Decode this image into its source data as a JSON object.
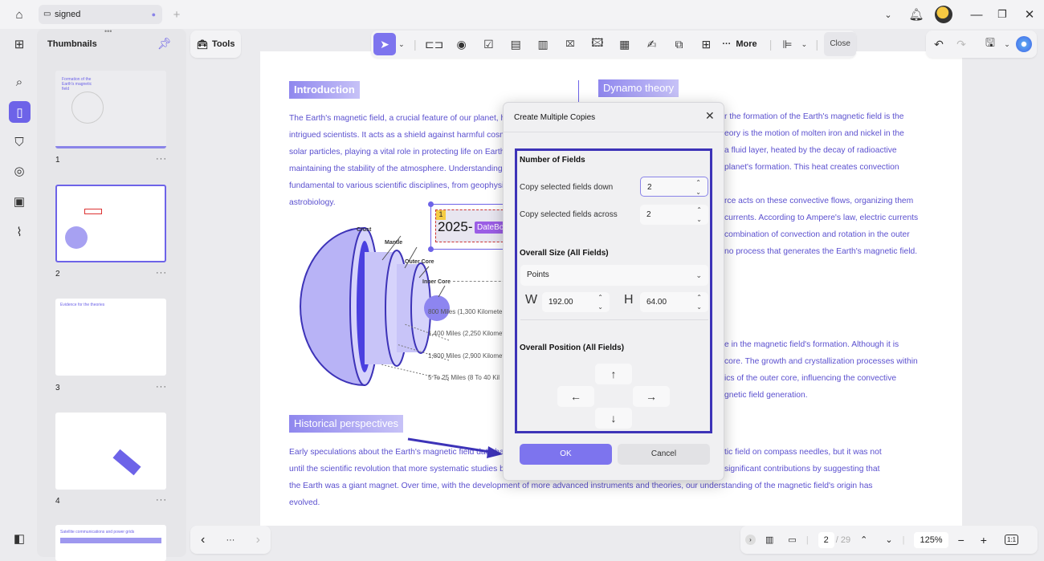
{
  "titlebar": {
    "tab_title": "signed",
    "icons": [
      "home-icon",
      "comment-icon",
      "plus-icon",
      "chevron-down-icon",
      "bell-icon",
      "avatar",
      "minimize-icon",
      "maximize-icon",
      "close-icon"
    ]
  },
  "rail": {
    "icons": [
      "grid-icon",
      "search-icon",
      "pages-icon",
      "bookmark-icon",
      "comment-search-icon",
      "stamp-icon",
      "attachment-icon",
      "layers-icon"
    ]
  },
  "thumbnails": {
    "title": "Thumbnails",
    "pages": [
      {
        "num": "1",
        "title": "Formation of the Earth's magnetic field"
      },
      {
        "num": "2",
        "title": ""
      },
      {
        "num": "3",
        "title": "Evidence for the theories"
      },
      {
        "num": "4",
        "title": ""
      },
      {
        "num": "5",
        "title": "Satellite communications and power grids"
      }
    ],
    "selected": "2"
  },
  "tools": {
    "label": "Tools",
    "more_label": "More",
    "close_label": "Close"
  },
  "document": {
    "intro_heading": "Introduction",
    "intro_lines": [
      "The Earth's magnetic field, a crucial feature of our planet, has",
      "intrigued scientists. It acts as a shield against harmful cosmic",
      " solar particles, playing a vital role in protecting life on Earth a",
      "maintaining the stability of the atmosphere. Understanding its",
      "fundamental to various scientific disciplines, from geophysics",
      "astrobiology."
    ],
    "dynamo_heading": "Dynamo theory",
    "dynamo_lines": [
      "r the formation of the Earth's magnetic field is the",
      "eory is the motion of molten iron and nickel in the",
      " a fluid layer, heated by the decay of radioactive",
      " planet's formation. This heat creates convection",
      "",
      "rce acts on these convective flows, organizing them",
      "currents. According to Ampere's law, electric currents",
      " combination of convection and rotation in the outer",
      "no process that generates the Earth's magnetic field."
    ],
    "inner_lines": [
      "e in the magnetic field's formation. Although it is",
      "core. The growth and crystallization processes within",
      "ics of the outer core, influencing the convective",
      "gnetic field generation."
    ],
    "hist_heading": "Historical perspectives",
    "hist_left": [
      "Early speculations about the Earth's magnetic field date back",
      "until the scientific revolution that more systematic studies beg"
    ],
    "hist_right": [
      "tic field on compass needles, but it was not",
      " significant contributions by suggesting that"
    ],
    "hist_full": [
      "the Earth was a giant magnet. Over time, with the development of more advanced instruments and theories, our understanding of the magnetic field's origin has",
      "evolved."
    ],
    "diagram_labels": {
      "crust": "Crust",
      "mantle": "Mantle",
      "outer": "Outer Core",
      "inner": "Inner Core",
      "d1": "800 Miles (1,300 Kilomete",
      "d2": "1,400 Miles (2,250 Kilomet",
      "d3": "1,800 Miles (2,900 Kilomet",
      "d4": "5 To 25 Miles (8 To 40 Kil"
    },
    "date_field": {
      "badge": "1",
      "value": "2025-",
      "tag": "DateBox"
    }
  },
  "dialog": {
    "title": "Create Multiple Copies",
    "num_fields": "Number of Fields",
    "down_label": "Copy selected fields down",
    "down_value": "2",
    "across_label": "Copy selected fields across",
    "across_value": "2",
    "size_heading": "Overall Size (All Fields)",
    "unit": "Points",
    "w_label": "W",
    "w_value": "192.00",
    "h_label": "H",
    "h_value": "64.00",
    "position_heading": "Overall Position (All Fields)",
    "ok": "OK",
    "cancel": "Cancel"
  },
  "statusbar": {
    "page": "2",
    "total": "/ 29",
    "zoom": "125%",
    "fit": "1:1"
  },
  "colors": {
    "accent": "#6d63e8",
    "doc_text": "#5b50cf",
    "annotation": "#3d33b8"
  }
}
